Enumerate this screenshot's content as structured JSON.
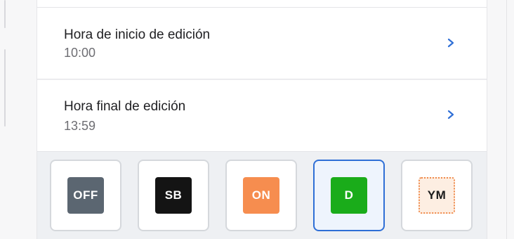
{
  "settings": {
    "start_time": {
      "label": "Hora de inicio de edición",
      "value": "10:00"
    },
    "end_time": {
      "label": "Hora final de edición",
      "value": "13:59"
    }
  },
  "status_buttons": [
    {
      "text": "OFF",
      "color": "#5b6671",
      "text_color": "#ffffff",
      "selected": false
    },
    {
      "text": "SB",
      "color": "#141414",
      "text_color": "#ffffff",
      "selected": false
    },
    {
      "text": "ON",
      "color": "#f68d4f",
      "text_color": "#ffffff",
      "selected": false
    },
    {
      "text": "D",
      "color": "#1aac1a",
      "text_color": "#ffffff",
      "selected": true
    },
    {
      "text": "YM",
      "color": "#fdeee2",
      "text_color": "#1a1a1a",
      "selected": false,
      "border": "dotted #f08a4b"
    }
  ],
  "accent_color": "#2f6fd6",
  "icons": {
    "chevron": "chevron-right-icon"
  }
}
